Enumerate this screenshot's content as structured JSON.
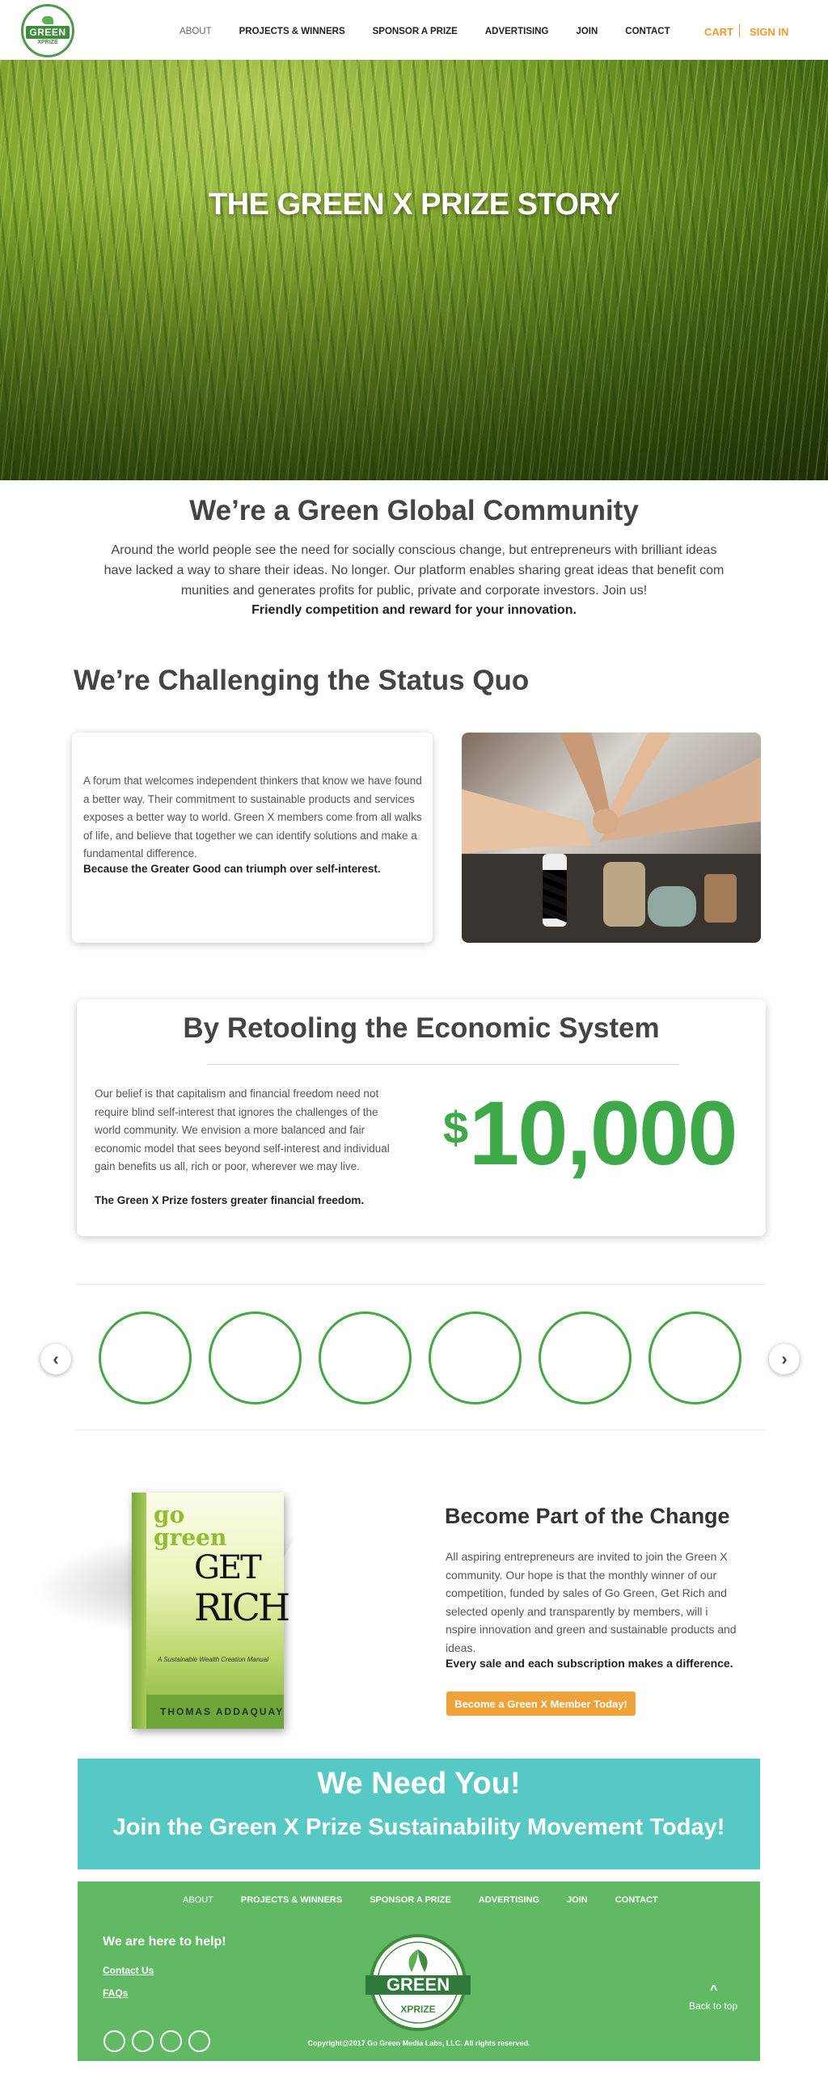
{
  "brand": {
    "logo_text": "GREEN",
    "logo_sub": "XPRIZE"
  },
  "nav": {
    "items": [
      "ABOUT",
      "PROJECTS & WINNERS",
      "SPONSOR A PRIZE",
      "ADVERTISING",
      "JOIN",
      "CONTACT"
    ]
  },
  "header": {
    "cart": "CART",
    "signin": "SIGN IN"
  },
  "hero": {
    "title": "THE GREEN X PRIZE STORY"
  },
  "community": {
    "title": "We’re a Green Global Community",
    "text": "Around the world people see the need for socially conscious change, but entrepreneurs with brilliant ideas have lacked a way to share their ideas. No longer. Our platform enables sharing great ideas that benefit com munities and generates profits for public, private and corporate investors. Join us!",
    "bold": "Friendly competition and reward for your innovation."
  },
  "challenge": {
    "title": "We’re Challenging the Status Quo",
    "text": "A forum that welcomes independent thinkers that know we have found a better way.  Their commitment to sustainable products and services exposes a better way to world. Green X members come from all walks of life, and believe that together we can identify solutions and make a fundamental difference.",
    "bold": "Because the Greater Good can triumph over self-interest."
  },
  "retool": {
    "title": "By Retooling the Economic System",
    "text": "Our belief is that capitalism and financial freedom need not require blind self-interest that ignores the challenges of the world community.  We envision a more balanced and fair economic model that sees beyond self-interest and individual gain benefits us all, rich or poor, wherever we may live.",
    "bold": "The Green X Prize fosters greater financial freedom.",
    "prize_currency": "$",
    "prize_amount": "10,000"
  },
  "carousel": {
    "prev": "‹",
    "next": "›",
    "ring_count": 6
  },
  "book": {
    "line1": "go",
    "line2": "green",
    "line3": "GET",
    "line4": "RICH",
    "tagline": "A Sustainable Wealth Creation Manual",
    "author": "THOMAS ADDAQUAY"
  },
  "change": {
    "title": "Become Part of the Change",
    "text": "All aspiring entrepreneurs are invited to join the Green X community.  Our hope is that the monthly winner of our competition, funded by sales of Go Green, Get Rich and selected openly and transparently by members, will i nspire innovation and green and sustainable products and ideas.",
    "bold": "Every sale and each subscription makes a difference.",
    "cta": "Become a Green X Member Today!"
  },
  "need": {
    "title": "We Need You!",
    "subtitle": "Join the Green X Prize Sustainability Movement Today!"
  },
  "footer": {
    "help": "We are here to help!",
    "contact": "Contact Us",
    "faq": "FAQs",
    "copyright": "Copyright@2017 Go Green Media Labs, LLC. All rights reserved.",
    "back_to_top": "Back to top",
    "back_icon": "^"
  },
  "colors": {
    "accent_orange": "#ef9b2c",
    "brand_green": "#3fa94a",
    "teal": "#57c9c5",
    "footer_green": "#62b964"
  }
}
